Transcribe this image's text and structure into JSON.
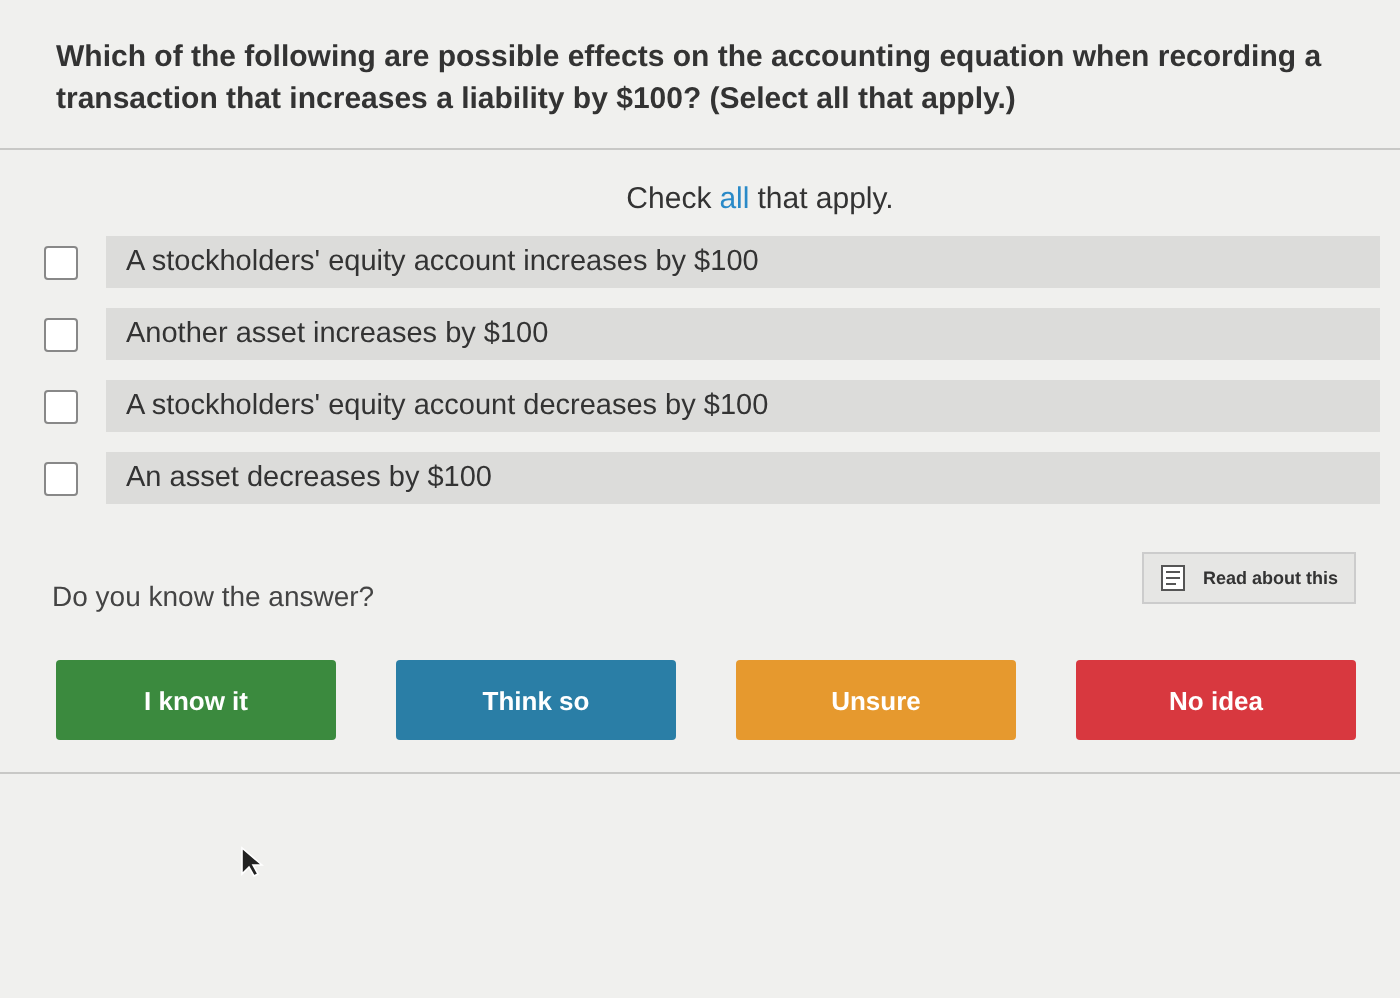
{
  "question": "Which of the following are possible effects on the accounting equation when recording a transaction that increases a liability by $100? (Select all that apply.)",
  "instruction": {
    "before": "Check",
    "highlight": "all",
    "after": "that apply."
  },
  "options": [
    {
      "label": "A stockholders' equity account increases by $100",
      "checked": false
    },
    {
      "label": "Another asset increases by $100",
      "checked": false
    },
    {
      "label": "A stockholders' equity account decreases by $100",
      "checked": false
    },
    {
      "label": "An asset decreases by $100",
      "checked": false
    }
  ],
  "confidence": {
    "prompt": "Do you know the answer?",
    "read_link": "Read about this",
    "buttons": [
      {
        "label": "I know it",
        "color": "#3b8a3e"
      },
      {
        "label": "Think so",
        "color": "#2a7ea6"
      },
      {
        "label": "Unsure",
        "color": "#e6992e"
      },
      {
        "label": "No idea",
        "color": "#d8383f"
      }
    ]
  }
}
